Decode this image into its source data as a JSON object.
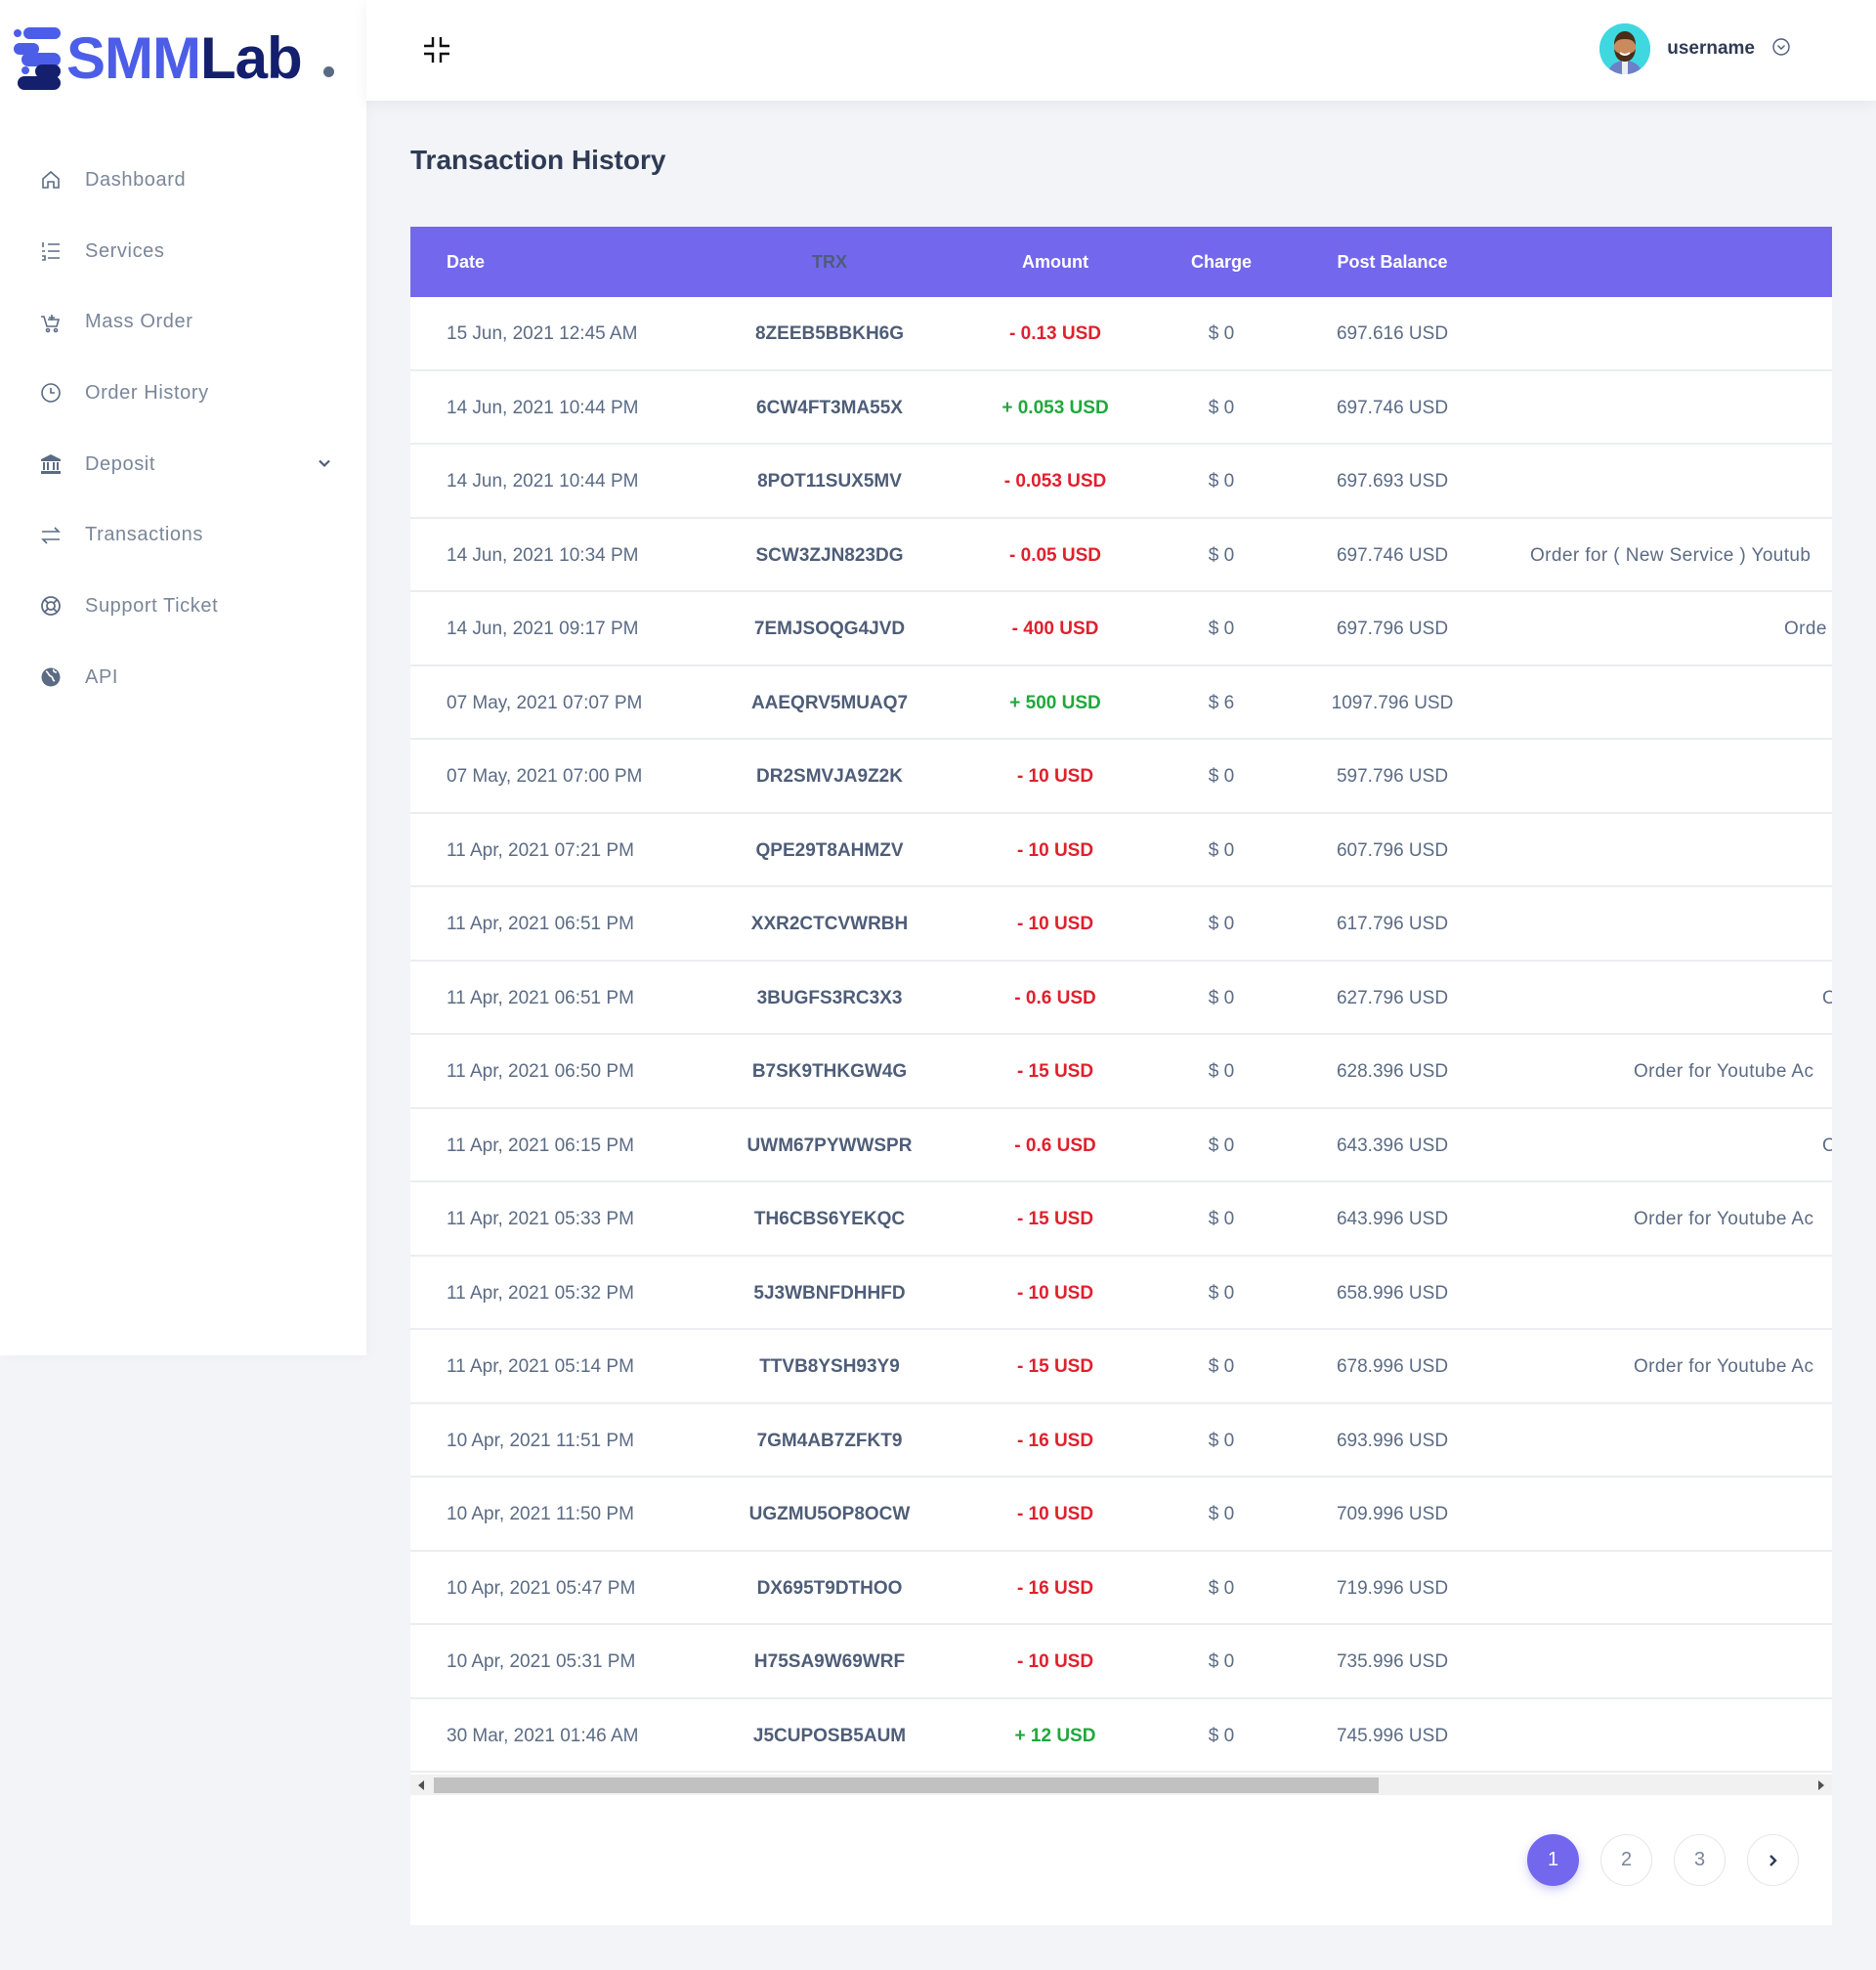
{
  "brand": {
    "logo_text_a": "SMM",
    "logo_text_b": "Lab",
    "colors": {
      "primary": "#7367ee",
      "logo_blue": "#4c5ee8",
      "logo_navy": "#141f6e",
      "negative": "#e0202d",
      "positive": "#1fa83c"
    }
  },
  "sidebar": {
    "items": [
      {
        "label": "Dashboard",
        "icon": "home-icon"
      },
      {
        "label": "Services",
        "icon": "list-ordered-icon"
      },
      {
        "label": "Mass Order",
        "icon": "cart-plus-icon"
      },
      {
        "label": "Order History",
        "icon": "clock-icon"
      },
      {
        "label": "Deposit",
        "icon": "bank-icon",
        "has_submenu": true
      },
      {
        "label": "Transactions",
        "icon": "exchange-icon"
      },
      {
        "label": "Support Ticket",
        "icon": "lifebuoy-icon"
      },
      {
        "label": "API",
        "icon": "globe-icon"
      }
    ]
  },
  "header": {
    "username": "username",
    "collapse_icon": "compress-icon",
    "dropdown_icon": "chevron-circle-down-icon"
  },
  "page": {
    "title": "Transaction History"
  },
  "table": {
    "columns": [
      "Date",
      "TRX",
      "Amount",
      "Charge",
      "Post Balance"
    ],
    "rows": [
      {
        "date": "15 Jun, 2021 12:45 AM",
        "trx": "8ZEEB5BBKH6G",
        "amount": "- 0.13 USD",
        "type": "neg",
        "charge": "$ 0",
        "balance": "697.616 USD",
        "details": ""
      },
      {
        "date": "14 Jun, 2021 10:44 PM",
        "trx": "6CW4FT3MA55X",
        "amount": "+ 0.053 USD",
        "type": "pos",
        "charge": "$ 0",
        "balance": "697.746 USD",
        "details": ""
      },
      {
        "date": "14 Jun, 2021 10:44 PM",
        "trx": "8POT11SUX5MV",
        "amount": "- 0.053 USD",
        "type": "neg",
        "charge": "$ 0",
        "balance": "697.693 USD",
        "details": ""
      },
      {
        "date": "14 Jun, 2021 10:34 PM",
        "trx": "SCW3ZJN823DG",
        "amount": "- 0.05 USD",
        "type": "neg",
        "charge": "$ 0",
        "balance": "697.746 USD",
        "details": "Order for ( New Service ) Youtub"
      },
      {
        "date": "14 Jun, 2021 09:17 PM",
        "trx": "7EMJSOQG4JVD",
        "amount": "- 400 USD",
        "type": "neg",
        "charge": "$ 0",
        "balance": "697.796 USD",
        "details": "Orde"
      },
      {
        "date": "07 May, 2021 07:07 PM",
        "trx": "AAEQRV5MUAQ7",
        "amount": "+ 500 USD",
        "type": "pos",
        "charge": "$ 6",
        "balance": "1097.796 USD",
        "details": ""
      },
      {
        "date": "07 May, 2021 07:00 PM",
        "trx": "DR2SMVJA9Z2K",
        "amount": "- 10 USD",
        "type": "neg",
        "charge": "$ 0",
        "balance": "597.796 USD",
        "details": ""
      },
      {
        "date": "11 Apr, 2021 07:21 PM",
        "trx": "QPE29T8AHMZV",
        "amount": "- 10 USD",
        "type": "neg",
        "charge": "$ 0",
        "balance": "607.796 USD",
        "details": ""
      },
      {
        "date": "11 Apr, 2021 06:51 PM",
        "trx": "XXR2CTCVWRBH",
        "amount": "- 10 USD",
        "type": "neg",
        "charge": "$ 0",
        "balance": "617.796 USD",
        "details": ""
      },
      {
        "date": "11 Apr, 2021 06:51 PM",
        "trx": "3BUGFS3RC3X3",
        "amount": "- 0.6 USD",
        "type": "neg",
        "charge": "$ 0",
        "balance": "627.796 USD",
        "details": "O"
      },
      {
        "date": "11 Apr, 2021 06:50 PM",
        "trx": "B7SK9THKGW4G",
        "amount": "- 15 USD",
        "type": "neg",
        "charge": "$ 0",
        "balance": "628.396 USD",
        "details": "Order for Youtube Ac"
      },
      {
        "date": "11 Apr, 2021 06:15 PM",
        "trx": "UWM67PYWWSPR",
        "amount": "- 0.6 USD",
        "type": "neg",
        "charge": "$ 0",
        "balance": "643.396 USD",
        "details": "O"
      },
      {
        "date": "11 Apr, 2021 05:33 PM",
        "trx": "TH6CBS6YEKQC",
        "amount": "- 15 USD",
        "type": "neg",
        "charge": "$ 0",
        "balance": "643.996 USD",
        "details": "Order for Youtube Ac"
      },
      {
        "date": "11 Apr, 2021 05:32 PM",
        "trx": "5J3WBNFDHHFD",
        "amount": "- 10 USD",
        "type": "neg",
        "charge": "$ 0",
        "balance": "658.996 USD",
        "details": ""
      },
      {
        "date": "11 Apr, 2021 05:14 PM",
        "trx": "TTVB8YSH93Y9",
        "amount": "- 15 USD",
        "type": "neg",
        "charge": "$ 0",
        "balance": "678.996 USD",
        "details": "Order for Youtube Ac"
      },
      {
        "date": "10 Apr, 2021 11:51 PM",
        "trx": "7GM4AB7ZFKT9",
        "amount": "- 16 USD",
        "type": "neg",
        "charge": "$ 0",
        "balance": "693.996 USD",
        "details": ""
      },
      {
        "date": "10 Apr, 2021 11:50 PM",
        "trx": "UGZMU5OP8OCW",
        "amount": "- 10 USD",
        "type": "neg",
        "charge": "$ 0",
        "balance": "709.996 USD",
        "details": ""
      },
      {
        "date": "10 Apr, 2021 05:47 PM",
        "trx": "DX695T9DTHOO",
        "amount": "- 16 USD",
        "type": "neg",
        "charge": "$ 0",
        "balance": "719.996 USD",
        "details": ""
      },
      {
        "date": "10 Apr, 2021 05:31 PM",
        "trx": "H75SA9W69WRF",
        "amount": "- 10 USD",
        "type": "neg",
        "charge": "$ 0",
        "balance": "735.996 USD",
        "details": ""
      },
      {
        "date": "30 Mar, 2021 01:46 AM",
        "trx": "J5CUPOSB5AUM",
        "amount": "+ 12 USD",
        "type": "pos",
        "charge": "$ 0",
        "balance": "745.996 USD",
        "details": ""
      }
    ]
  },
  "pagination": {
    "pages": [
      "1",
      "2",
      "3"
    ],
    "current": "1",
    "next_icon": "chevron-right-icon"
  }
}
